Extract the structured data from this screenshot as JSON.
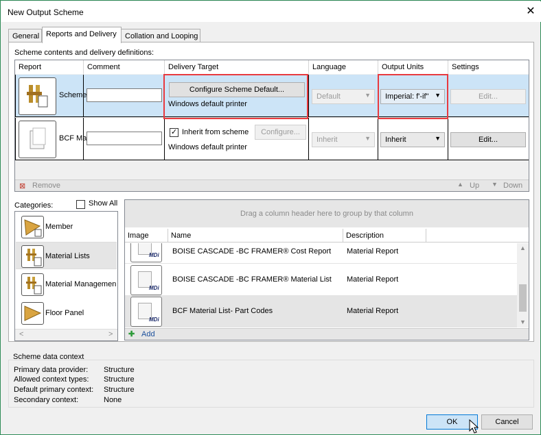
{
  "window": {
    "title": "New Output Scheme",
    "close_glyph": "✕"
  },
  "tabs": [
    {
      "label": "General"
    },
    {
      "label": "Reports and Delivery"
    },
    {
      "label": "Collation and Looping"
    }
  ],
  "scheme": {
    "caption": "Scheme contents and delivery definitions:",
    "headers": {
      "report": "Report",
      "comment": "Comment",
      "delivery": "Delivery Target",
      "language": "Language",
      "units": "Output Units",
      "settings": "Settings"
    },
    "rows": [
      {
        "name": "Scheme",
        "comment": "",
        "delivery_button": "Configure Scheme Default...",
        "printer": "Windows default printer",
        "language": "Default",
        "units": "Imperial: f'-if\"",
        "settings": "Edit..."
      },
      {
        "name": "BCF Ma",
        "comment": "",
        "inherit_label": "Inherit from scheme",
        "inherit_checked": true,
        "configure": "Configure...",
        "printer": "Windows default printer",
        "language": "Inherit",
        "units": "Inherit",
        "settings": "Edit..."
      }
    ],
    "remove": "Remove",
    "up": "Up",
    "down": "Down"
  },
  "categories": {
    "label": "Categories:",
    "show_all": "Show All",
    "items": [
      "Member",
      "Material Lists",
      "Material Managemen",
      "Floor Panel"
    ]
  },
  "library": {
    "group_hint": "Drag a column header here to group by that column",
    "headers": {
      "image": "Image",
      "name": "Name",
      "description": "Description"
    },
    "rows": [
      {
        "name": "BOISE CASCADE -BC FRAMER® Cost Report",
        "description": "Material Report"
      },
      {
        "name": "BOISE CASCADE -BC FRAMER® Material List",
        "description": "Material Report"
      },
      {
        "name": "BCF Material List- Part Codes",
        "description": "Material Report"
      }
    ],
    "add": "Add"
  },
  "context": {
    "title": "Scheme data context",
    "fields": [
      {
        "label": "Primary data provider:",
        "value": "Structure"
      },
      {
        "label": "Allowed context types:",
        "value": "Structure"
      },
      {
        "label": "Default primary context:",
        "value": "Structure"
      },
      {
        "label": "Secondary context:",
        "value": "None"
      }
    ]
  },
  "buttons": {
    "ok": "OK",
    "cancel": "Cancel"
  },
  "colors": {
    "highlight": "#cce4f7",
    "annotation": "#e8393e",
    "ok_accent": "#0078d7"
  }
}
